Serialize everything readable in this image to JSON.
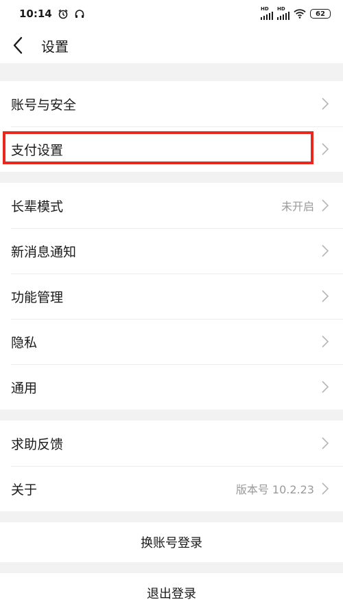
{
  "status_bar": {
    "time": "10:14",
    "alarm_icon": "alarm-clock-icon",
    "headphone_icon": "headphones-icon",
    "sim1_label": "HD",
    "sim2_label": "HD",
    "wifi_icon": "wifi-icon",
    "battery": "62"
  },
  "nav": {
    "back_icon": "chevron-left-icon",
    "title": "设置"
  },
  "groups": [
    {
      "items": [
        {
          "label": "账号与安全",
          "value": ""
        },
        {
          "label": "支付设置",
          "value": ""
        }
      ]
    },
    {
      "items": [
        {
          "label": "长辈模式",
          "value": "未开启"
        },
        {
          "label": "新消息通知",
          "value": ""
        },
        {
          "label": "功能管理",
          "value": ""
        },
        {
          "label": "隐私",
          "value": ""
        },
        {
          "label": "通用",
          "value": ""
        }
      ]
    },
    {
      "items": [
        {
          "label": "求助反馈",
          "value": ""
        },
        {
          "label": "关于",
          "value": "版本号 10.2.23"
        }
      ]
    }
  ],
  "actions": {
    "switch_account": "换账号登录",
    "logout": "退出登录"
  },
  "colors": {
    "highlight": "#e8281e",
    "background": "#f2f2f2",
    "value_text": "#9a9a9a"
  }
}
